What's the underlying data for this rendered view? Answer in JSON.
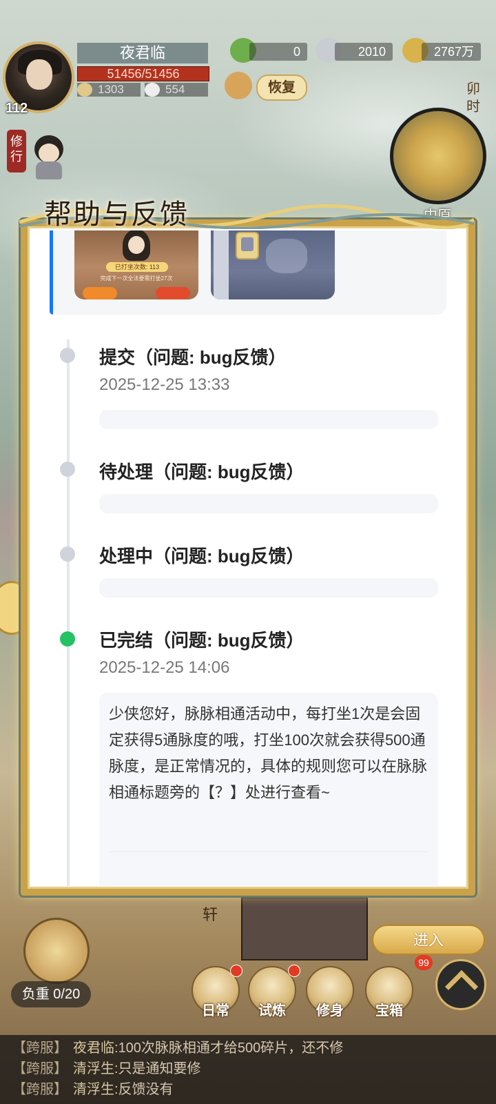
{
  "hud": {
    "player_name": "夜君临",
    "level": "112",
    "hp": "51456/51456",
    "stat_a": "1303",
    "stat_b": "554",
    "resources": [
      {
        "icon": "jade-icon",
        "value": "0"
      },
      {
        "icon": "silver-ingot-icon",
        "value": "2010"
      },
      {
        "icon": "gold-coin-icon",
        "value": "2767万"
      }
    ],
    "recover_label": "恢复",
    "time_label": "卯时",
    "region": "中原",
    "practice_label": "修行"
  },
  "dialog": {
    "title": "帮助与反馈",
    "screenshot_1": {
      "pill_text": "已打坐次数: 113",
      "small_text": "完成下一次全法要需打坐27次"
    },
    "timeline": [
      {
        "status": "提交（问题: bug反馈）",
        "time": "2025-12-25 13:33",
        "done": false
      },
      {
        "status": "待处理（问题: bug反馈）",
        "time": "",
        "done": false
      },
      {
        "status": "处理中（问题: bug反馈）",
        "time": "",
        "done": false
      },
      {
        "status": "已完结（问题: bug反馈）",
        "time": "2025-12-25 14:06",
        "done": true
      }
    ],
    "reply": "少侠您好，脉脉相通活动中，每打坐1次是会固定获得5通脉度的哦，打坐100次就会获得500通脉度，是正常情况的，具体的规则您可以在脉脉相通标题旁的【？】处进行查看~"
  },
  "bottom": {
    "load_label": "负重 0/20",
    "enter_label": "进入",
    "xuan_label": "轩",
    "nav": [
      {
        "label": "日常",
        "icon": "daily-icon",
        "has_dot": true
      },
      {
        "label": "试炼",
        "icon": "trial-icon",
        "has_dot": true
      },
      {
        "label": "修身",
        "icon": "cultivate-icon",
        "has_dot": false
      },
      {
        "label": "宝箱",
        "icon": "treasure-chest-icon",
        "has_dot": false
      }
    ],
    "chest_badge": "99"
  },
  "chat": [
    {
      "channel": "【跨服】",
      "sender": "夜君临:",
      "text": "100次脉脉相通才给500碎片，还不修"
    },
    {
      "channel": "【跨服】",
      "sender": "清浮生:",
      "text": "只是通知要修"
    },
    {
      "channel": "【跨服】",
      "sender": "清浮生:",
      "text": "反馈没有"
    }
  ]
}
